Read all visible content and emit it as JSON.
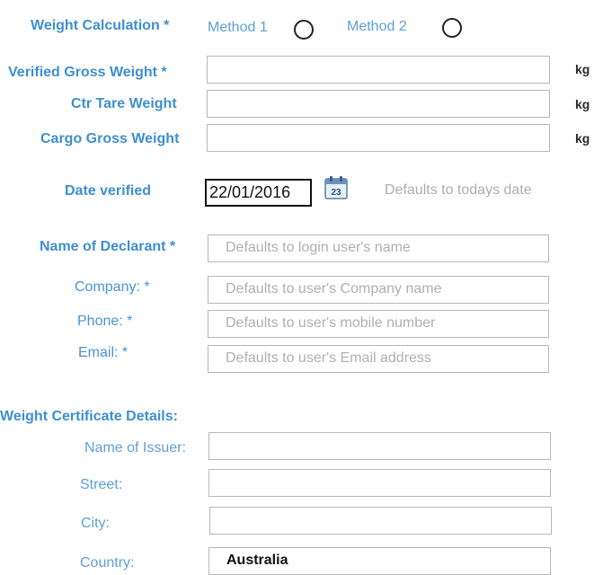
{
  "weight_calculation": {
    "label": "Weight Calculation *",
    "method1": "Method 1",
    "method2": "Method 2"
  },
  "vgm": {
    "label": "Verified Gross Weight *",
    "value": "",
    "unit": "kg"
  },
  "tare": {
    "label": "Ctr Tare Weight",
    "value": "",
    "unit": "kg"
  },
  "cargo": {
    "label": "Cargo Gross Weight",
    "value": "",
    "unit": "kg"
  },
  "date_verified": {
    "label": "Date verified",
    "value": "22/01/2016",
    "calendar_day": "23",
    "hint": "Defaults to todays date"
  },
  "declarant": {
    "label": "Name of Declarant *",
    "placeholder": "Defaults to login user's name"
  },
  "company": {
    "label": "Company: *",
    "placeholder": "Defaults to user's Company name"
  },
  "phone": {
    "label": "Phone: *",
    "placeholder": "Defaults to user's mobile number"
  },
  "email": {
    "label": "Email: *",
    "placeholder": "Defaults to user's Email address"
  },
  "certificate": {
    "heading": "Weight Certificate Details:",
    "issuer_label": "Name of Issuer:",
    "street_label": "Street:",
    "city_label": "City:",
    "country_label": "Country:",
    "country_value": "Australia"
  }
}
